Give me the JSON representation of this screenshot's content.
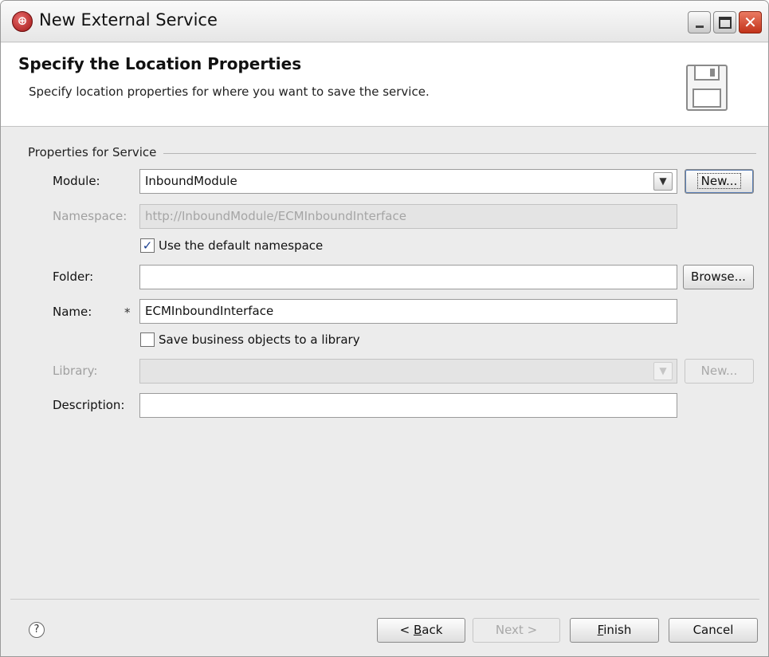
{
  "window": {
    "title": "New External Service"
  },
  "header": {
    "title": "Specify the Location Properties",
    "description": "Specify location properties for where you want to save the service."
  },
  "group": {
    "label": "Properties for Service"
  },
  "form": {
    "module": {
      "label": "Module:",
      "value": "InboundModule",
      "new_button": "New..."
    },
    "namespace": {
      "label": "Namespace:",
      "value": "http://InboundModule/ECMInboundInterface"
    },
    "use_default_namespace": {
      "label": "Use the default namespace",
      "checked": true
    },
    "folder": {
      "label": "Folder:",
      "value": "",
      "browse_button": "Browse..."
    },
    "name": {
      "label": "Name:",
      "required_marker": "*",
      "value": "ECMInboundInterface"
    },
    "save_to_library": {
      "label": "Save business objects to a library",
      "checked": false
    },
    "library": {
      "label": "Library:",
      "value": "",
      "new_button": "New..."
    },
    "description": {
      "label": "Description:",
      "value": ""
    }
  },
  "footer": {
    "help": "?",
    "back_prefix": "< ",
    "back_mnemonic": "B",
    "back_rest": "ack",
    "next": "Next >",
    "finish_mnemonic": "F",
    "finish_rest": "inish",
    "cancel": "Cancel"
  }
}
